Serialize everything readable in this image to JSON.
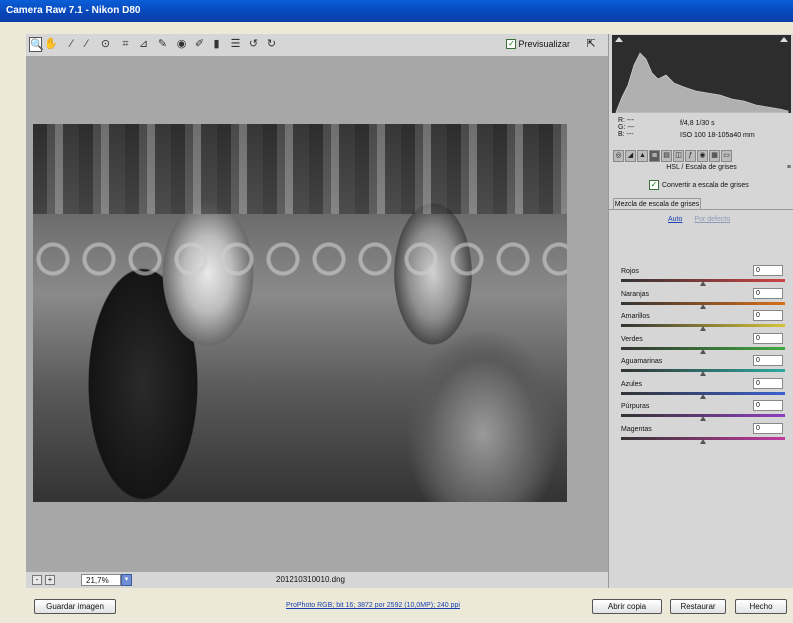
{
  "window": {
    "title": "Camera Raw 7.1 -  Nikon D80"
  },
  "toolbar": {
    "tools": [
      {
        "name": "zoom-tool-icon",
        "glyph": "🔍"
      },
      {
        "name": "hand-tool-icon",
        "glyph": "✋"
      },
      {
        "name": "white-balance-tool-icon",
        "glyph": "⁄"
      },
      {
        "name": "color-sampler-tool-icon",
        "glyph": "⁄"
      },
      {
        "name": "targeted-adjustment-tool-icon",
        "glyph": "⊙"
      },
      {
        "name": "crop-tool-icon",
        "glyph": "⌗"
      },
      {
        "name": "straighten-tool-icon",
        "glyph": "⊿"
      },
      {
        "name": "spot-removal-tool-icon",
        "glyph": "✎"
      },
      {
        "name": "red-eye-tool-icon",
        "glyph": "◉"
      },
      {
        "name": "adjustment-brush-icon",
        "glyph": "✐"
      },
      {
        "name": "graduated-filter-icon",
        "glyph": "▮"
      },
      {
        "name": "preferences-icon",
        "glyph": "☰"
      },
      {
        "name": "rotate-left-icon",
        "glyph": "↺"
      },
      {
        "name": "rotate-right-icon",
        "glyph": "↻"
      }
    ],
    "preview_label": "Previsualizar",
    "preview_checked": "✓"
  },
  "status": {
    "zoom_out": "-",
    "zoom_in": "+",
    "zoom_value": "21,7%",
    "zoom_dropdown": "▾",
    "filename": "201210310010.dng"
  },
  "info": {
    "r": "R:   ---",
    "g": "G:   ---",
    "b": "B:   ---",
    "aperture_shutter": "f/4,8   1/30 s",
    "iso_lens": "ISO 100   18-105a40 mm"
  },
  "panel": {
    "title": "HSL / Escala de grises",
    "menu": "≡",
    "convert_label": "Convertir a escala de grises",
    "convert_checked": "✓",
    "subtab": "Mezcla de escala de grises",
    "auto_link": "Auto",
    "default_link": "Por defecto",
    "sliders": [
      {
        "label": "Rojos",
        "value": "0",
        "track": "#c44"
      },
      {
        "label": "Naranjas",
        "value": "0",
        "track": "#d8701a"
      },
      {
        "label": "Amarillos",
        "value": "0",
        "track": "#d6c33a"
      },
      {
        "label": "Verdes",
        "value": "0",
        "track": "#3fa93f"
      },
      {
        "label": "Aguamarinas",
        "value": "0",
        "track": "#2eaaa0"
      },
      {
        "label": "Azules",
        "value": "0",
        "track": "#3b5fd0"
      },
      {
        "label": "Púrpuras",
        "value": "0",
        "track": "#8f3fbf"
      },
      {
        "label": "Magentas",
        "value": "0",
        "track": "#c03aa0"
      }
    ]
  },
  "bottom": {
    "save_label": "Guardar imagen",
    "workflow_label": "ProPhoto RGB; bit 16; 3872 por 2592 (10,0MP); 240 ppi",
    "open_label": "Abrir copia",
    "reset_label": "Restaurar",
    "done_label": "Hecho"
  }
}
